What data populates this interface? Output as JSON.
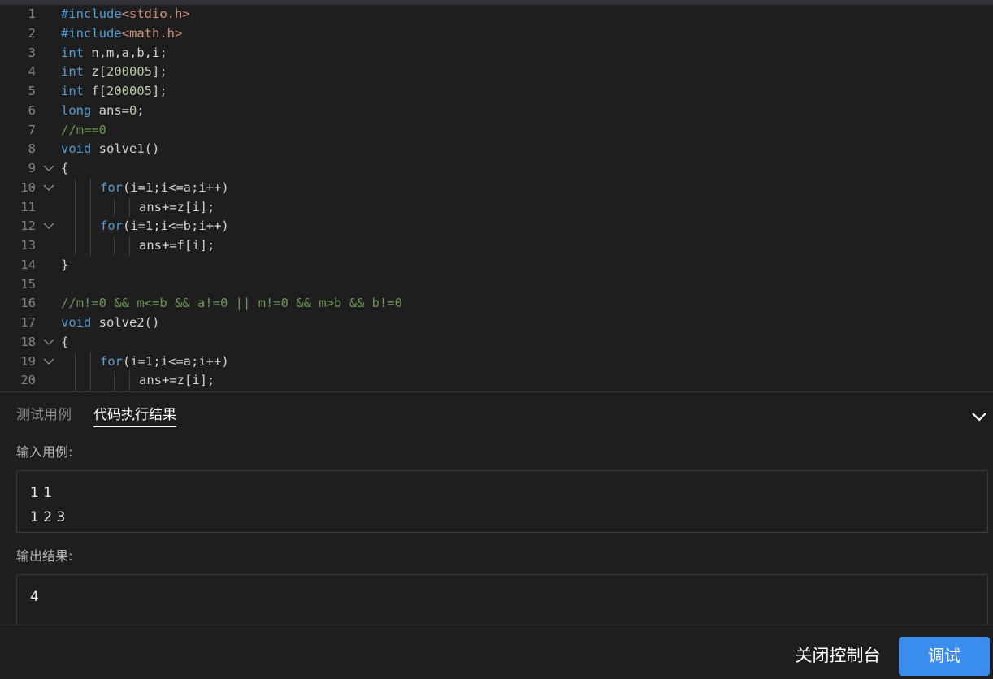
{
  "editor": {
    "lines": [
      {
        "num": "1",
        "tokens": [
          {
            "t": "#include",
            "c": "k"
          },
          {
            "t": "<stdio.h>",
            "c": "s"
          }
        ]
      },
      {
        "num": "2",
        "tokens": [
          {
            "t": "#include",
            "c": "k"
          },
          {
            "t": "<math.h>",
            "c": "s"
          }
        ]
      },
      {
        "num": "3",
        "tokens": [
          {
            "t": "int",
            "c": "k"
          },
          {
            "t": " n,m,a,b,i;",
            "c": "p"
          }
        ]
      },
      {
        "num": "4",
        "tokens": [
          {
            "t": "int",
            "c": "k"
          },
          {
            "t": " z[",
            "c": "p"
          },
          {
            "t": "200005",
            "c": "n"
          },
          {
            "t": "];",
            "c": "p"
          }
        ]
      },
      {
        "num": "5",
        "tokens": [
          {
            "t": "int",
            "c": "k"
          },
          {
            "t": " f[",
            "c": "p"
          },
          {
            "t": "200005",
            "c": "n"
          },
          {
            "t": "];",
            "c": "p"
          }
        ]
      },
      {
        "num": "6",
        "tokens": [
          {
            "t": "long",
            "c": "k"
          },
          {
            "t": " ans=",
            "c": "p"
          },
          {
            "t": "0",
            "c": "n"
          },
          {
            "t": ";",
            "c": "p"
          }
        ]
      },
      {
        "num": "7",
        "tokens": [
          {
            "t": "//m==0",
            "c": "c"
          }
        ]
      },
      {
        "num": "8",
        "tokens": [
          {
            "t": "void",
            "c": "k"
          },
          {
            "t": " solve1()",
            "c": "p"
          }
        ]
      },
      {
        "num": "9",
        "fold": true,
        "tokens": [
          {
            "t": "{",
            "c": "p"
          }
        ]
      },
      {
        "num": "10",
        "fold": true,
        "indent": 1,
        "tokens": [
          {
            "t": "for",
            "c": "k"
          },
          {
            "t": "(i=1;i<=a;i++)",
            "c": "p"
          }
        ]
      },
      {
        "num": "11",
        "indent": 2,
        "tokens": [
          {
            "t": "ans+=z[i];",
            "c": "p"
          }
        ]
      },
      {
        "num": "12",
        "fold": true,
        "indent": 1,
        "tokens": [
          {
            "t": "for",
            "c": "k"
          },
          {
            "t": "(i=1;i<=b;i++)",
            "c": "p"
          }
        ]
      },
      {
        "num": "13",
        "indent": 2,
        "tokens": [
          {
            "t": "ans+=f[i];",
            "c": "p"
          }
        ]
      },
      {
        "num": "14",
        "tokens": [
          {
            "t": "}",
            "c": "p"
          }
        ]
      },
      {
        "num": "15",
        "tokens": []
      },
      {
        "num": "16",
        "tokens": [
          {
            "t": "//m!=0 && m<=b && a!=0 || m!=0 && m>b && b!=0",
            "c": "c"
          }
        ]
      },
      {
        "num": "17",
        "tokens": [
          {
            "t": "void",
            "c": "k"
          },
          {
            "t": " solve2()",
            "c": "p"
          }
        ]
      },
      {
        "num": "18",
        "fold": true,
        "tokens": [
          {
            "t": "{",
            "c": "p"
          }
        ]
      },
      {
        "num": "19",
        "fold": true,
        "indent": 1,
        "tokens": [
          {
            "t": "for",
            "c": "k"
          },
          {
            "t": "(i=1;i<=a;i++)",
            "c": "p"
          }
        ]
      },
      {
        "num": "20",
        "indent": 2,
        "tokens": [
          {
            "t": "ans+=z[i];",
            "c": "p"
          }
        ]
      }
    ]
  },
  "console": {
    "tabs": [
      "测试用例",
      "代码执行结果"
    ],
    "input_label": "输入用例:",
    "input_value": "1 1\n1 2 3",
    "output_label": "输出结果:",
    "output_value": "4"
  },
  "footer": {
    "close_label": "关闭控制台",
    "debug_label": "调试"
  },
  "colors": {
    "keyword": "#569cd6",
    "string": "#ce9178",
    "number": "#b5cea8",
    "comment": "#6a9955",
    "accent": "#3b8ded"
  }
}
